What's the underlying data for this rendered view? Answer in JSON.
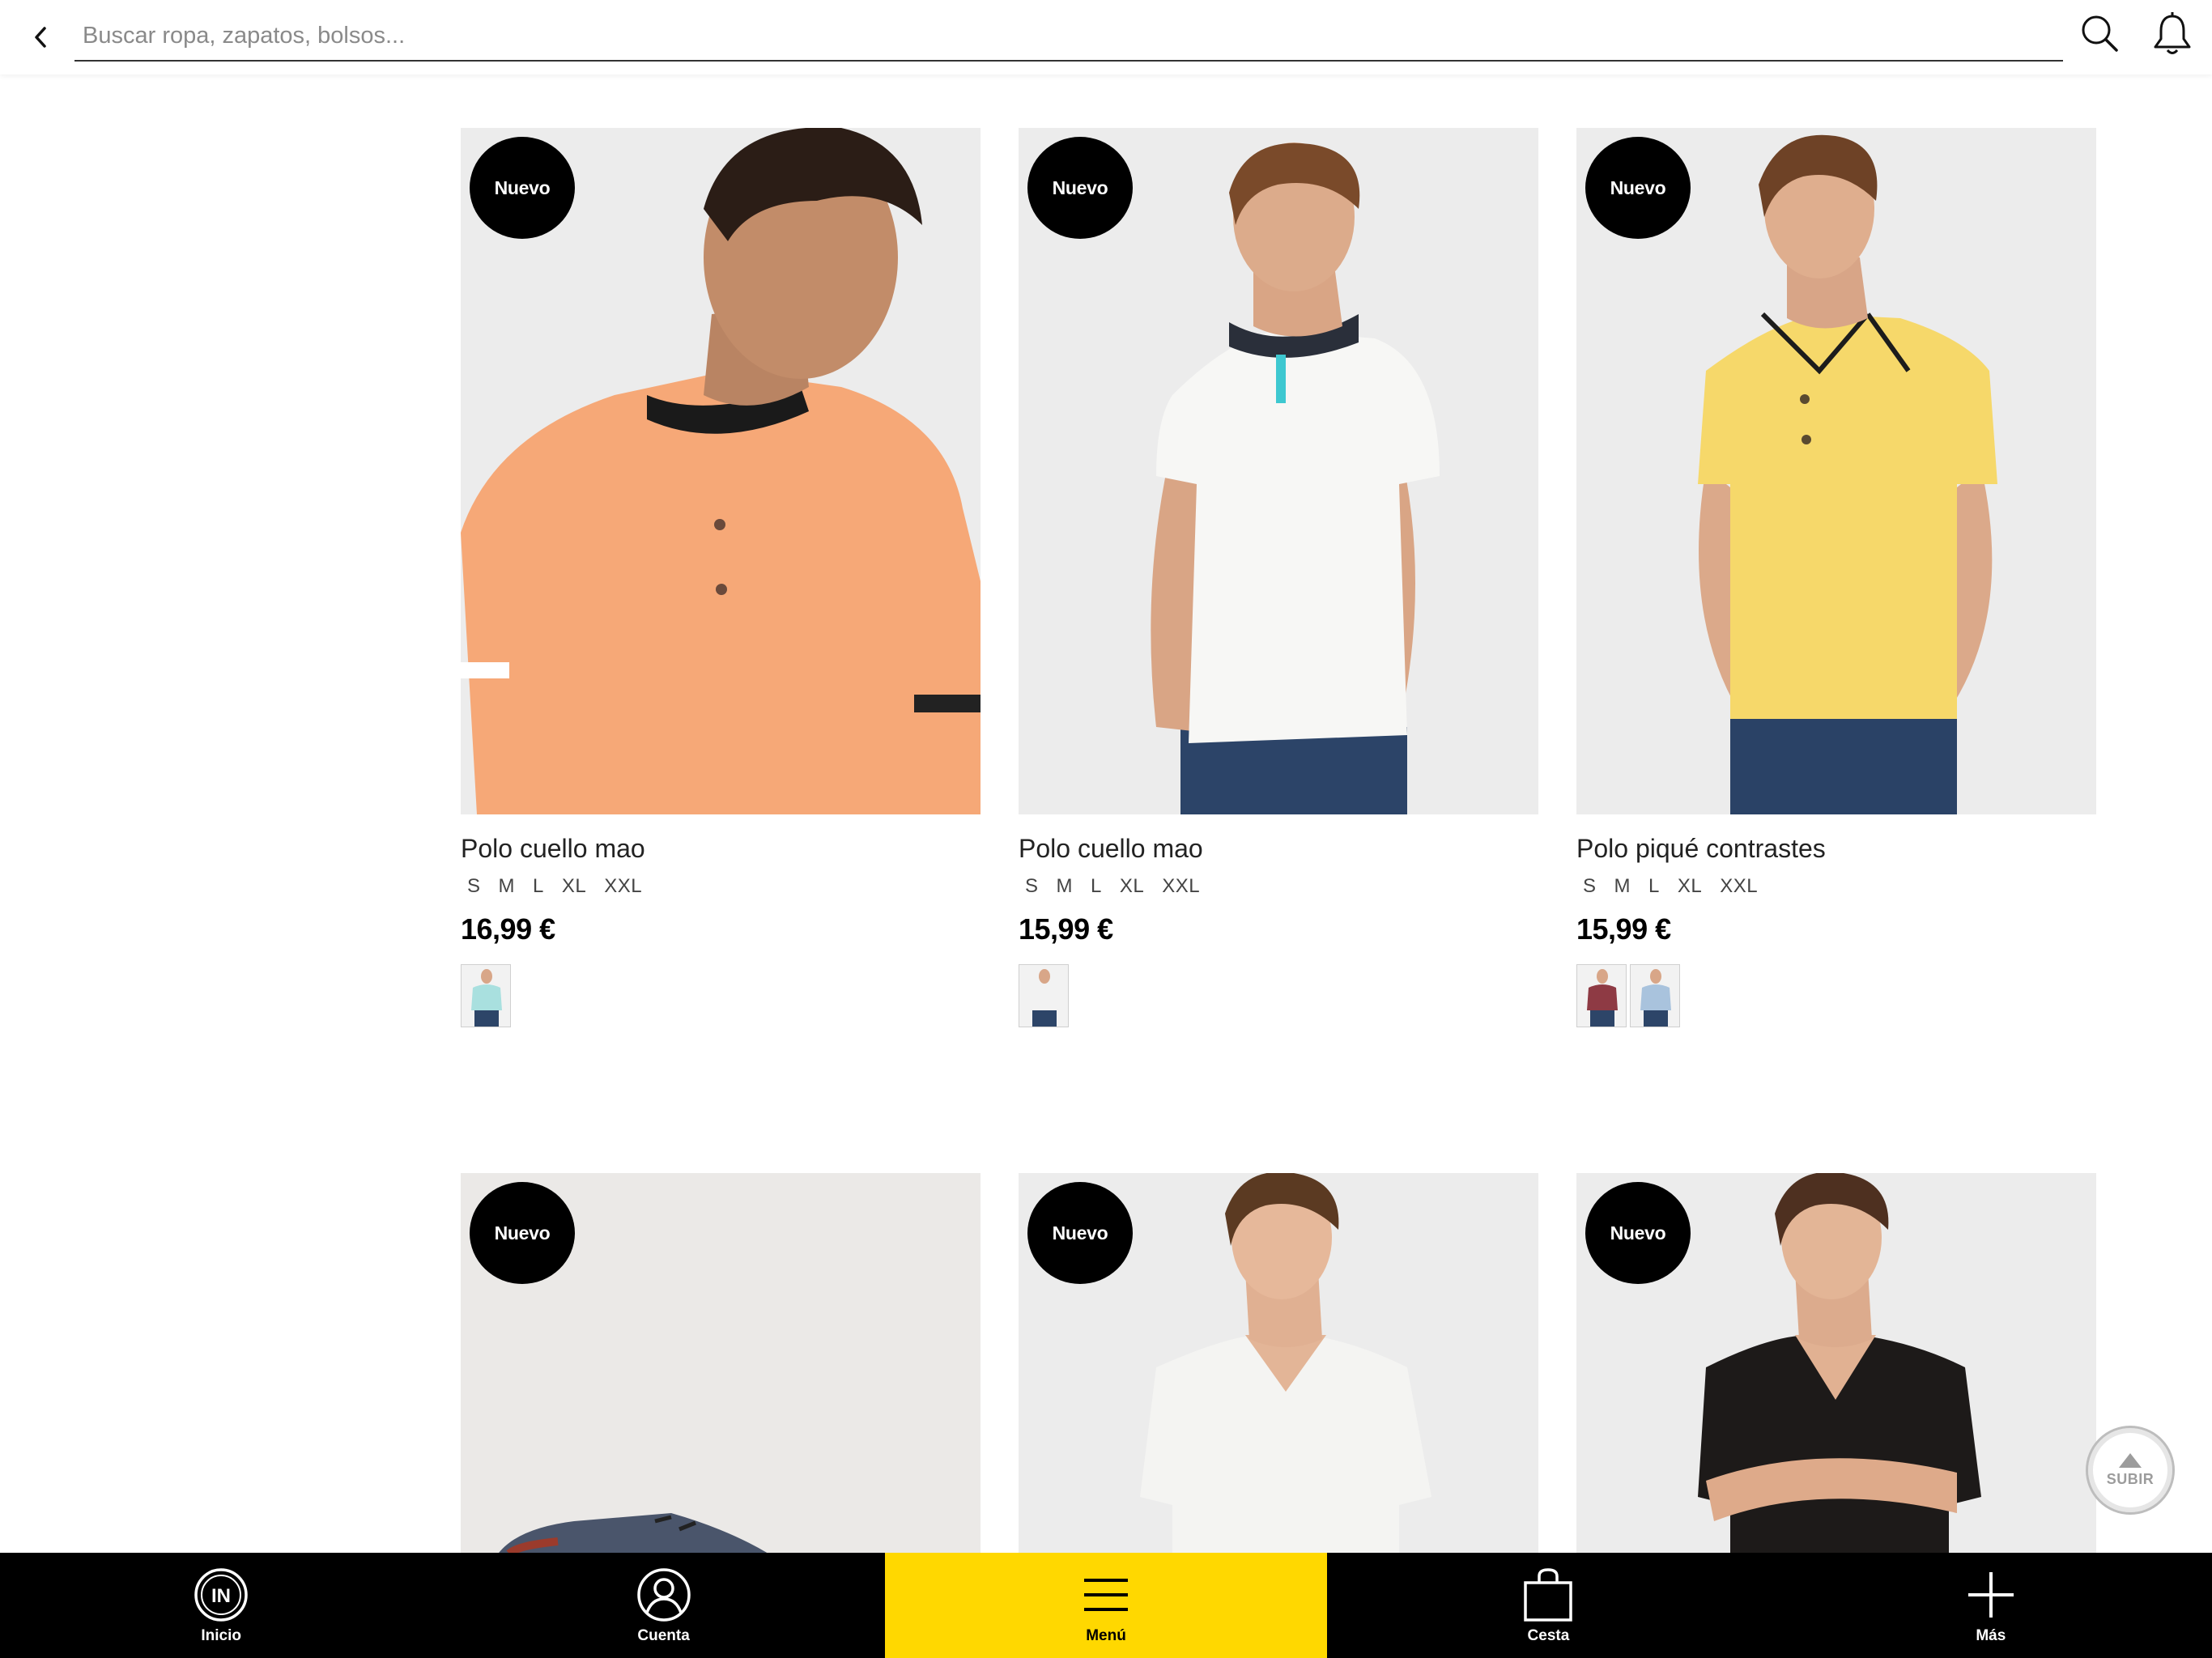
{
  "header": {
    "back_icon": "chevron-left-icon",
    "search_placeholder": "Buscar ropa, zapatos, bolsos...",
    "search_value": "",
    "search_icon": "search-icon",
    "notifications_icon": "bell-icon"
  },
  "products": [
    {
      "badge": "Nuevo",
      "name": "Polo cuello mao",
      "sizes": [
        "S",
        "M",
        "L",
        "XL",
        "XXL"
      ],
      "price": "16,99 €",
      "shirt_color": "#f6a877",
      "swatches": [
        "#a9e0df"
      ]
    },
    {
      "badge": "Nuevo",
      "name": "Polo cuello mao",
      "sizes": [
        "S",
        "M",
        "L",
        "XL",
        "XXL"
      ],
      "price": "15,99 €",
      "shirt_color": "#f7f7f5",
      "swatches": [
        "#f2f2f2"
      ]
    },
    {
      "badge": "Nuevo",
      "name": "Polo piqué contrastes",
      "sizes": [
        "S",
        "M",
        "L",
        "XL",
        "XXL"
      ],
      "price": "15,99 €",
      "shirt_color": "#f6d86a",
      "swatches": [
        "#8e3a44",
        "#a9c3dd"
      ]
    },
    {
      "badge": "Nuevo",
      "product_image": "sneaker"
    },
    {
      "badge": "Nuevo",
      "shirt_color": "#f4f4f2"
    },
    {
      "badge": "Nuevo",
      "shirt_color": "#1d1a19"
    }
  ],
  "scroll_top": {
    "label": "SUBIR",
    "icon": "arrow-up-icon"
  },
  "bottom_nav": [
    {
      "label": "Inicio",
      "icon": "in-logo-icon",
      "active": false
    },
    {
      "label": "Cuenta",
      "icon": "user-icon",
      "active": false
    },
    {
      "label": "Menú",
      "icon": "hamburger-menu-icon",
      "active": true
    },
    {
      "label": "Cesta",
      "icon": "shopping-bag-icon",
      "active": false
    },
    {
      "label": "Más",
      "icon": "plus-icon",
      "active": false
    }
  ],
  "colors": {
    "accent": "#ffd800",
    "nav_background": "#000000",
    "badge": "#000000"
  }
}
